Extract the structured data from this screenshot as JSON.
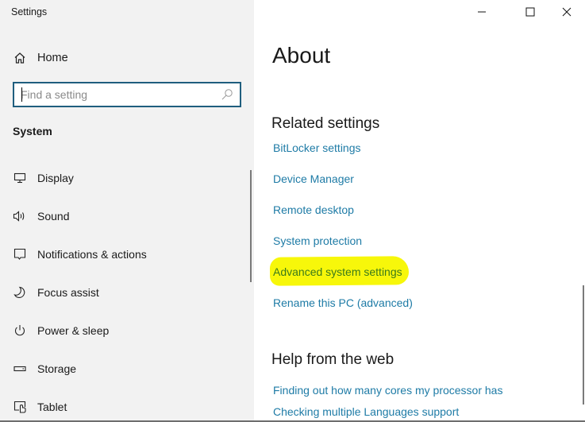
{
  "window": {
    "title": "Settings",
    "controls": {
      "minimize": "minimize",
      "maximize": "maximize",
      "close": "close"
    }
  },
  "sidebar": {
    "home_label": "Home",
    "search": {
      "placeholder": "Find a setting",
      "value": ""
    },
    "section_label": "System",
    "items": [
      {
        "label": "Display",
        "icon": "display-icon"
      },
      {
        "label": "Sound",
        "icon": "sound-icon"
      },
      {
        "label": "Notifications & actions",
        "icon": "notifications-icon"
      },
      {
        "label": "Focus assist",
        "icon": "moon-icon"
      },
      {
        "label": "Power & sleep",
        "icon": "power-icon"
      },
      {
        "label": "Storage",
        "icon": "storage-icon"
      },
      {
        "label": "Tablet",
        "icon": "tablet-icon"
      }
    ]
  },
  "main": {
    "page_title": "About",
    "related_settings": {
      "heading": "Related settings",
      "links": [
        {
          "label": "BitLocker settings"
        },
        {
          "label": "Device Manager"
        },
        {
          "label": "Remote desktop"
        },
        {
          "label": "System protection"
        },
        {
          "label": "Advanced system settings",
          "highlighted": true
        },
        {
          "label": "Rename this PC (advanced)"
        }
      ]
    },
    "help": {
      "heading": "Help from the web",
      "links": [
        {
          "label": "Finding out how many cores my processor has"
        },
        {
          "label": "Checking multiple Languages support"
        }
      ]
    }
  },
  "colors": {
    "link": "#1e7ba6",
    "highlight": "#f7f70a",
    "search_border": "#1f5e7e",
    "sidebar_bg": "#f2f2f2"
  }
}
